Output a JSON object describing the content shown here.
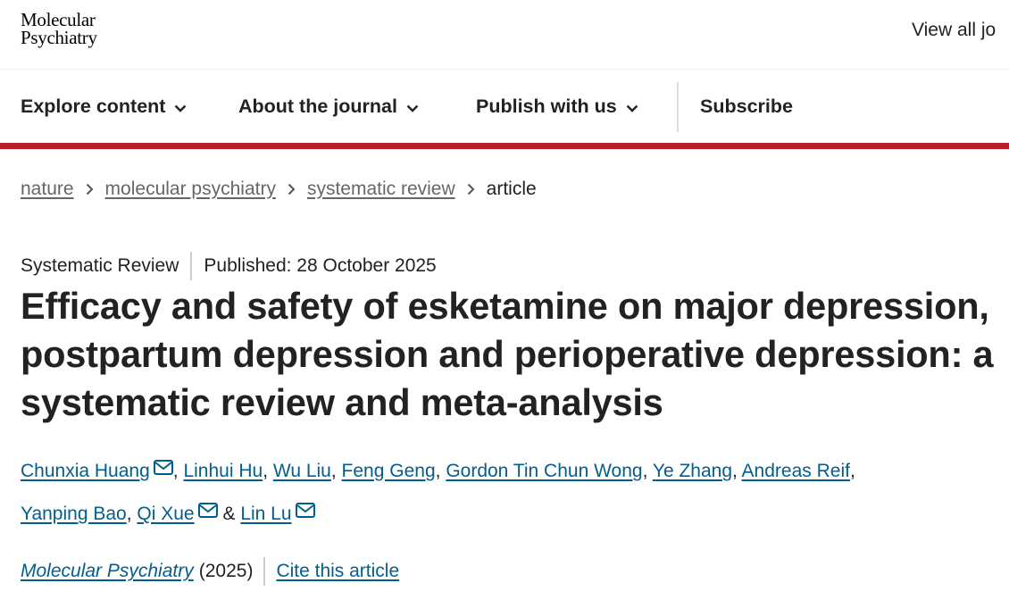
{
  "header": {
    "logo_line1": "Molecular",
    "logo_line2": "Psychiatry",
    "view_all": "View all jo"
  },
  "nav": {
    "explore": "Explore content",
    "about": "About the journal",
    "publish": "Publish with us",
    "subscribe": "Subscribe"
  },
  "breadcrumb": [
    "nature",
    "molecular psychiatry",
    "systematic review",
    "article"
  ],
  "article": {
    "type": "Systematic Review",
    "published": "Published: 28 October 2025",
    "title": "Efficacy and safety of esketamine on major depression, postpartum depression and perioperative depression: a systematic review and meta-analysis",
    "authors": [
      {
        "name": "Chunxia Huang",
        "mail": true
      },
      {
        "name": "Linhui Hu",
        "mail": false
      },
      {
        "name": "Wu Liu",
        "mail": false
      },
      {
        "name": "Feng Geng",
        "mail": false
      },
      {
        "name": "Gordon Tin Chun Wong",
        "mail": false
      },
      {
        "name": "Ye Zhang",
        "mail": false
      },
      {
        "name": "Andreas Reif",
        "mail": false
      },
      {
        "name": "Yanping Bao",
        "mail": false
      },
      {
        "name": "Qi Xue",
        "mail": true
      },
      {
        "name": "Lin Lu",
        "mail": true
      }
    ],
    "comma": ",",
    "ampersand": "&",
    "journal": "Molecular Psychiatry",
    "year": "(2025)",
    "cite": "Cite this article"
  },
  "colors": {
    "accent_red": "#b7202a",
    "link_blue": "#025e8d",
    "text": "#222222",
    "muted": "#666666"
  }
}
